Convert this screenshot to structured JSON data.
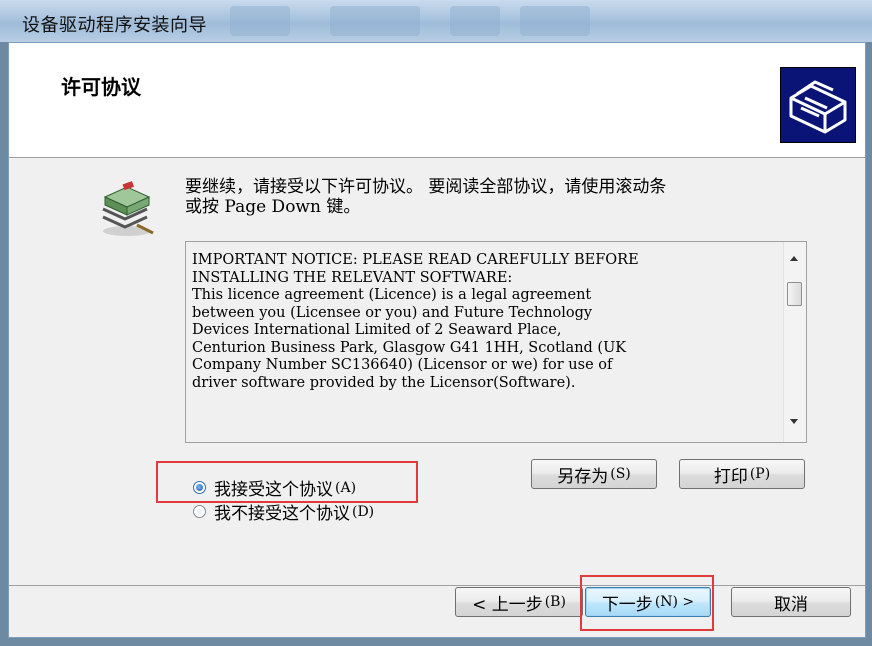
{
  "window": {
    "title": "设备驱动程序安装向导"
  },
  "header": {
    "title": "许可协议"
  },
  "intro": {
    "line1": "要继续，请接受以下许可协议。 要阅读全部协议，请使用滚动条",
    "line2": "或按 Page Down 键。"
  },
  "license": {
    "text": "IMPORTANT NOTICE: PLEASE READ CAREFULLY BEFORE\nINSTALLING THE RELEVANT SOFTWARE:\nThis licence agreement (Licence) is a legal agreement\nbetween you (Licensee or you) and Future Technology\nDevices International Limited of 2 Seaward Place,\nCenturion Business Park, Glasgow G41 1HH, Scotland (UK\nCompany Number SC136640) (Licensor or we) for use of\ndriver software provided by the Licensor(Software)."
  },
  "options": {
    "accept": {
      "label": "我接受这个协议",
      "shortcut": "(A)",
      "selected": true
    },
    "decline": {
      "label": "我不接受这个协议",
      "shortcut": "(D)",
      "selected": false
    }
  },
  "buttons": {
    "save_as": {
      "label": "另存为",
      "shortcut": "(S)"
    },
    "print": {
      "label": "打印",
      "shortcut": "(P)"
    },
    "back": {
      "label": "< 上一步",
      "shortcut": "(B)"
    },
    "next": {
      "label": "下一步",
      "shortcut": "(N) >"
    },
    "cancel": {
      "label": "取消"
    }
  },
  "colors": {
    "highlight": "#e23a3a",
    "brand_bg": "#0a1476"
  }
}
